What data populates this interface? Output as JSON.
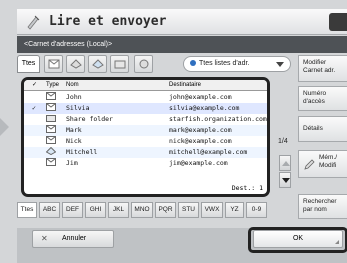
{
  "window": {
    "title": "Lire et envoyer"
  },
  "breadcrumb": "<Carnet d'adresses (Local)>",
  "filter": {
    "ttes_tab": "Ttes",
    "list_select": "Ttes listes d'adr."
  },
  "list": {
    "columns": {
      "type": "Type",
      "name": "Nom",
      "dest": "Destinataire"
    },
    "rows": [
      {
        "check": "",
        "type_icon": "email-icon",
        "name": "John",
        "dest": "john@example.com"
      },
      {
        "check": "✓",
        "type_icon": "email-icon",
        "name": "Silvia",
        "dest": "silvia@example.com"
      },
      {
        "check": "",
        "type_icon": "folder-icon",
        "name": "Share folder",
        "dest": "starfish.organization.com"
      },
      {
        "check": "",
        "type_icon": "email-icon",
        "name": "Mark",
        "dest": "mark@example.com"
      },
      {
        "check": "",
        "type_icon": "email-icon",
        "name": "Nick",
        "dest": "nick@example.com"
      },
      {
        "check": "",
        "type_icon": "group-icon",
        "name": "Mitchell",
        "dest": "mitchell@example.com"
      },
      {
        "check": "",
        "type_icon": "email-icon",
        "name": "Jim",
        "dest": "jim@example.com"
      }
    ],
    "footer": "Dest.:  1"
  },
  "pager": {
    "page": "1/4"
  },
  "alpha_tabs": [
    "Ttes",
    "ABC",
    "DEF",
    "GHI",
    "JKL",
    "MNO",
    "PQR",
    "STU",
    "VWX",
    "YZ",
    "0-9"
  ],
  "side": {
    "modify_address_book": "Modifier Carnet adr.",
    "access_number": "Numéro d'accès",
    "details": "Détails",
    "memo_modify": "Mém./ Modifi",
    "search_by_name": "Rechercher par nom"
  },
  "bottom": {
    "cancel": "Annuler",
    "ok": "OK"
  }
}
